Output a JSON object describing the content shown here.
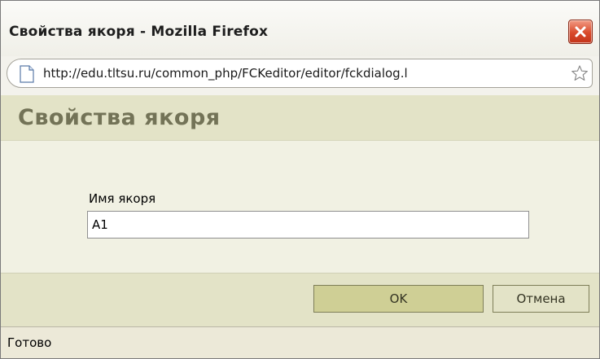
{
  "window": {
    "title": "Свойства якоря - Mozilla Firefox",
    "close_icon": "close-icon"
  },
  "urlbar": {
    "url": "http://edu.tltsu.ru/common_php/FCKeditor/editor/fckdialog.l",
    "page_icon": "page-icon",
    "bookmark_icon": "star-icon"
  },
  "dialog": {
    "title": "Свойства якоря",
    "anchor_name_label": "Имя якоря",
    "anchor_name_value": "A1",
    "ok_label": "OK",
    "cancel_label": "Отмена"
  },
  "status": {
    "text": "Готово"
  },
  "colors": {
    "header_band": "#e3e3c7",
    "content_bg": "#f1f1e3",
    "ok_button_bg": "#cfcf95",
    "close_button": "#d94a2b"
  }
}
